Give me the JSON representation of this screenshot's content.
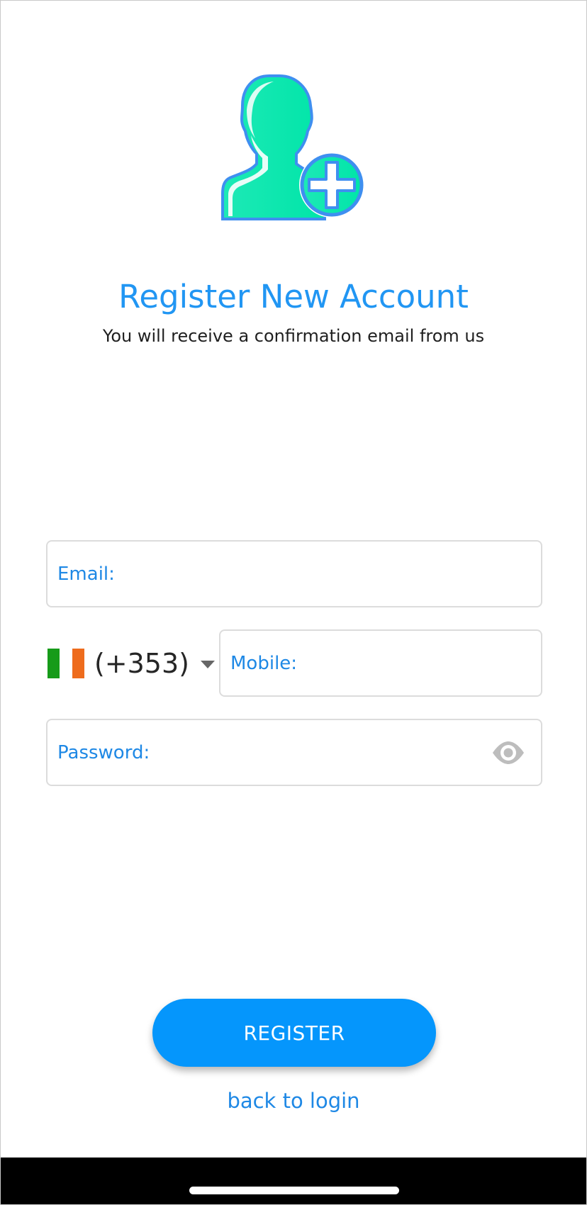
{
  "header": {
    "title": "Register New Account",
    "subtitle": "You will receive a confirmation email from us",
    "icon": "add-user-icon"
  },
  "form": {
    "email": {
      "placeholder": "Email:",
      "value": ""
    },
    "country": {
      "code": "(+353)",
      "flag_icon": "ireland-flag-icon",
      "flag_colors": [
        "#169b19",
        "#ffffff",
        "#ee6c1d"
      ]
    },
    "mobile": {
      "placeholder": "Mobile:",
      "value": ""
    },
    "password": {
      "placeholder": "Password:",
      "value": "",
      "toggle_icon": "eye-icon"
    }
  },
  "actions": {
    "register_label": "REGISTER",
    "back_to_login_label": "back to login"
  },
  "colors": {
    "accent": "#2196f3",
    "button": "#0596fc",
    "text": "#1f1f1f",
    "border": "#dcdcdc"
  }
}
